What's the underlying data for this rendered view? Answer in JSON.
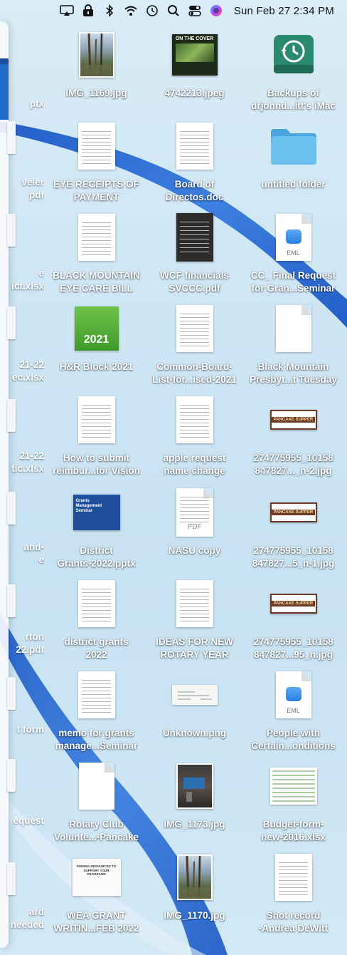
{
  "menubar": {
    "clock": "Sun Feb 27  2:34 PM",
    "icons": [
      "screen-mirroring-icon",
      "lock-icon",
      "bluetooth-icon",
      "wifi-icon",
      "time-machine-icon",
      "spotlight-search-icon",
      "control-center-icon",
      "siri-icon"
    ]
  },
  "left_column": [
    {
      "label": "ptx"
    },
    {
      "label": "veler"
    },
    {
      "label": "pdf"
    },
    {
      "label": "e"
    },
    {
      "label": "ict.xlsx"
    },
    {
      "label": "21-22"
    },
    {
      "label": "ec.xlsx"
    },
    {
      "label": "21-22"
    },
    {
      "label": "tic.xlsx"
    },
    {
      "label": "and-"
    },
    {
      "label": "e"
    },
    {
      "label": "rton"
    },
    {
      "label": "22.pdf"
    },
    {
      "label": "t form"
    },
    {
      "label": "equest"
    },
    {
      "label": "ard"
    },
    {
      "label": "needed"
    }
  ],
  "desktop": {
    "rows": [
      [
        {
          "line1": "IMG_1169.jpg",
          "line2": "",
          "kind": "photo-trees"
        },
        {
          "line1": "4742213.jpeg",
          "line2": "",
          "kind": "cover",
          "cover_text": "ON THE COVER"
        },
        {
          "line1": "Backups of",
          "line2": "drjohnd...itt's iMac",
          "kind": "backup"
        }
      ],
      [
        {
          "line1": "EYE RECEIPTS OF",
          "line2": "PAYMENT",
          "kind": "doc"
        },
        {
          "line1": "Board of",
          "line2": "Directos.doc",
          "kind": "doc"
        },
        {
          "line1": "untitled folder",
          "line2": "",
          "kind": "folder"
        }
      ],
      [
        {
          "line1": "BLACK MOUNTAIN",
          "line2": "EYE CARE BILL",
          "kind": "doc"
        },
        {
          "line1": "WCF financials",
          "line2": "SVCCC.pdf",
          "kind": "doc-dark"
        },
        {
          "line1": "CC_ Final Request",
          "line2": "for Gran...Seminar",
          "kind": "eml",
          "badge": "EML"
        }
      ],
      [
        {
          "line1": "H&R Block 2021",
          "line2": "",
          "kind": "hrblock",
          "badge": "2021"
        },
        {
          "line1": "Common-Board-",
          "line2": "List-for...ised-2021",
          "kind": "doc"
        },
        {
          "line1": "Black Mountain",
          "line2": "Presbyt...t Tuesday",
          "kind": "blank"
        }
      ],
      [
        {
          "line1": "How to submit",
          "line2": "reimbur...for Vision",
          "kind": "doc"
        },
        {
          "line1": "apple request",
          "line2": "name change",
          "kind": "doc"
        },
        {
          "line1": "274775955_10158",
          "line2": "847827..._n-2.jpg",
          "kind": "pancake",
          "badge": "PANCAKE SUPPER"
        }
      ],
      [
        {
          "line1": "District",
          "line2": "Grants-2022.pptx",
          "kind": "pptx",
          "title": "Grants Management Seminar"
        },
        {
          "line1": "NASU copy",
          "line2": "",
          "kind": "pdf",
          "badge": "PDF"
        },
        {
          "line1": "274775955_10158",
          "line2": "847827...5_n-1.jpg",
          "kind": "pancake",
          "badge": "PANCAKE SUPPER"
        }
      ],
      [
        {
          "line1": "district grants",
          "line2": "2022",
          "kind": "doc"
        },
        {
          "line1": "IDEAS FOR NEW",
          "line2": "ROTARY YEAR",
          "kind": "doc"
        },
        {
          "line1": "274775955_10158",
          "line2": "847827...95_n.jpg",
          "kind": "pancake",
          "badge": "PANCAKE SUPPER"
        }
      ],
      [
        {
          "line1": "memo for grants",
          "line2": "manage...Seminar",
          "kind": "doc"
        },
        {
          "line1": "Unknown.png",
          "line2": "",
          "kind": "check"
        },
        {
          "line1": "People with",
          "line2": "Certain...onditions",
          "kind": "eml",
          "badge": "EML"
        }
      ],
      [
        {
          "line1": "Rotary Club",
          "line2": "Volunte...-Pancake",
          "kind": "blank"
        },
        {
          "line1": "IMG_1173.jpg",
          "line2": "",
          "kind": "photo-room"
        },
        {
          "line1": "Budget-form-",
          "line2": "new-2016.xlsx",
          "kind": "sheet"
        }
      ],
      [
        {
          "line1": "WEA GRANT",
          "line2": "WRITIN...FEB 2022",
          "kind": "wea",
          "title": "FINDING RESOURCES TO SUPPORT YOUR PROGRAMS"
        },
        {
          "line1": "IMG_1170.jpg",
          "line2": "",
          "kind": "photo-trees"
        },
        {
          "line1": "Shot record",
          "line2": "-Andrea DeWitt",
          "kind": "doc"
        }
      ]
    ]
  },
  "colors": {
    "wallpaper_blue": "#1a5fd0",
    "folder_blue": "#5bb4ea",
    "hrblock_green": "#4aa532",
    "pptx_blue": "#1f4f9a",
    "pancake_brown": "#6b3b23"
  }
}
